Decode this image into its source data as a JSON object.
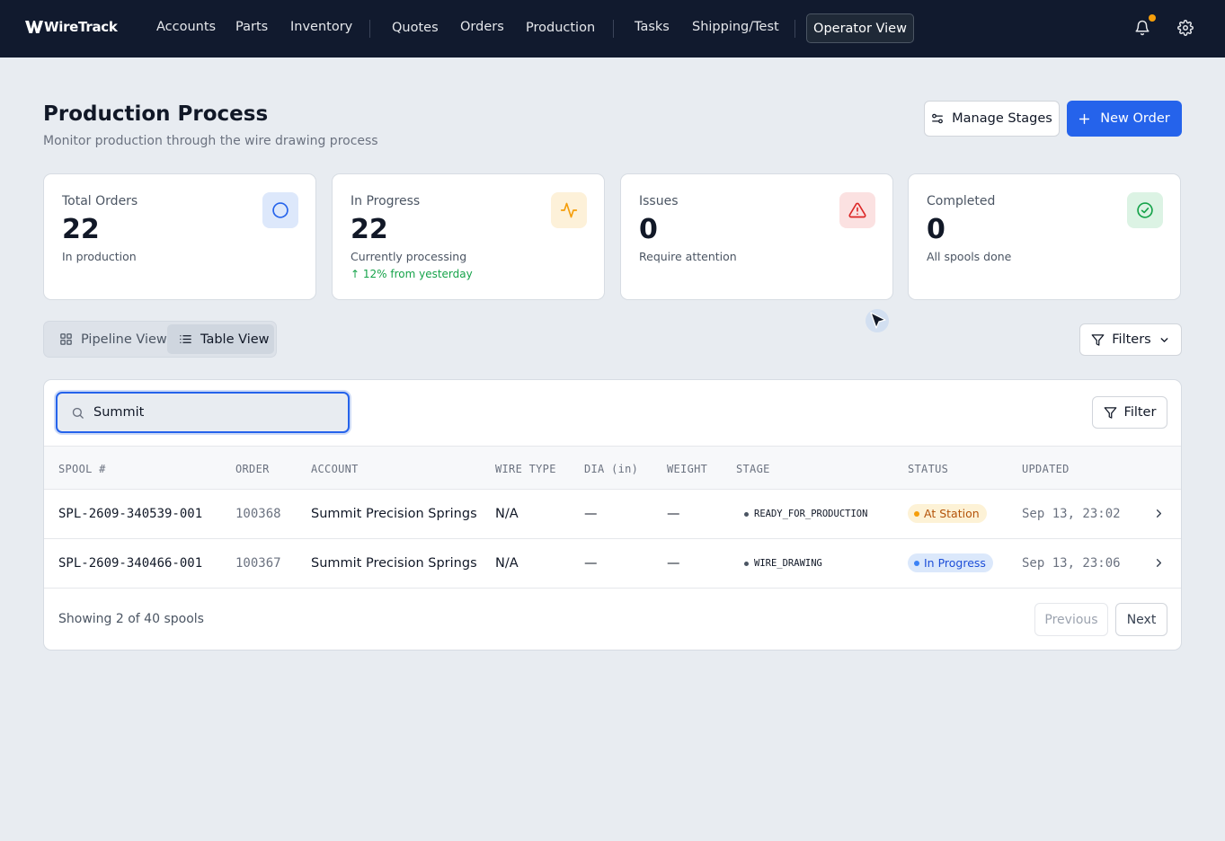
{
  "app": {
    "brand": "WireTrack"
  },
  "nav": {
    "items": [
      "Accounts",
      "Parts",
      "Inventory",
      "Quotes",
      "Orders",
      "Production",
      "Tasks",
      "Shipping/Test"
    ],
    "operator_view": "Operator View",
    "icons": [
      "bell-icon",
      "gear-icon"
    ],
    "notification_dot_color": "#f59e0b"
  },
  "header": {
    "title": "Production Process",
    "subtitle": "Monitor production through the wire drawing process",
    "manage_stages": "Manage Stages",
    "new_order": "New Order"
  },
  "stats": [
    {
      "label": "Total Orders",
      "value": "22",
      "note": "In production",
      "trend": "",
      "icon": "circle-icon",
      "color": "#2563eb"
    },
    {
      "label": "In Progress",
      "value": "22",
      "note": "Currently processing",
      "trend": "↑ 12% from yesterday",
      "icon": "activity-icon",
      "color": "#f59e0b"
    },
    {
      "label": "Issues",
      "value": "0",
      "note": "Require attention",
      "trend": "",
      "icon": "alert-triangle-icon",
      "color": "#dc2626"
    },
    {
      "label": "Completed",
      "value": "0",
      "note": "All spools done",
      "trend": "",
      "icon": "check-circle-icon",
      "color": "#16a34a"
    }
  ],
  "views": {
    "pipeline": "Pipeline View",
    "table": "Table View",
    "active": "table",
    "filters": "Filters"
  },
  "table": {
    "search_value": "Summit",
    "search_placeholder": "Search spools...",
    "filter_button": "Filter",
    "columns": [
      "SPOOL #",
      "ORDER",
      "ACCOUNT",
      "WIRE TYPE",
      "DIA (in)",
      "WEIGHT",
      "STAGE",
      "STATUS",
      "UPDATED"
    ],
    "rows": [
      {
        "spool": "SPL-2609-340539-001",
        "order": "100368",
        "account": "Summit Precision Springs",
        "wire_type": "N/A",
        "dia": "—",
        "weight": "—",
        "stage": "READY_FOR_PRODUCTION",
        "status": "At Station",
        "status_color": "#f59e0b",
        "updated": "Sep 13, 23:02"
      },
      {
        "spool": "SPL-2609-340466-001",
        "order": "100367",
        "account": "Summit Precision Springs",
        "wire_type": "N/A",
        "dia": "—",
        "weight": "—",
        "stage": "WIRE_DRAWING",
        "status": "In Progress",
        "status_color": "#3b82f6",
        "updated": "Sep 13, 23:06"
      }
    ],
    "footer": "Showing 2 of 40 spools",
    "prev": "Previous",
    "next": "Next"
  }
}
